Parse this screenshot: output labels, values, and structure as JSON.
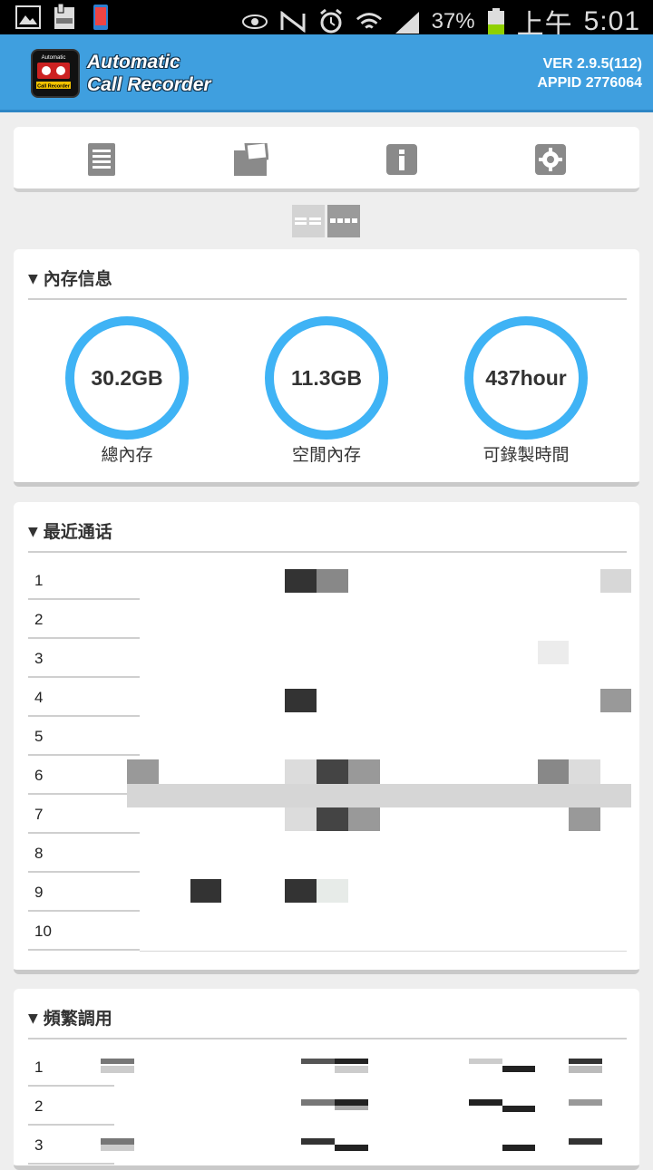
{
  "status_bar": {
    "battery_text": "37%",
    "time_period": "上午",
    "time": "5:01",
    "icons": [
      "gallery-icon",
      "galaxy-icon",
      "phone-icon",
      "eye-icon",
      "nfc-icon",
      "alarm-icon",
      "wifi-icon",
      "signal-icon",
      "battery-icon"
    ]
  },
  "header": {
    "title_line1": "Automatic",
    "title_line2": "Call Recorder",
    "logo_text_top": "Automatic",
    "logo_text_bottom": "Call Recorder",
    "version": "VER 2.9.5(112)",
    "appid": "APPID 2776064",
    "color": "#3f9fdf"
  },
  "toolbar": {
    "icons": [
      "list-icon",
      "folder-icon",
      "info-icon",
      "settings-icon"
    ]
  },
  "storage": {
    "title": "內存信息",
    "items": [
      {
        "value": "30.2GB",
        "label": "總內存"
      },
      {
        "value": "11.3GB",
        "label": "空閒內存"
      },
      {
        "value": "437hour",
        "label": "可錄製時間"
      }
    ],
    "ring_color": "#3fb3f5"
  },
  "recent": {
    "title": "最近通话",
    "rows": [
      "1",
      "2",
      "3",
      "4",
      "5",
      "6",
      "7",
      "8",
      "9",
      "10"
    ]
  },
  "frequent": {
    "title": "頻繁調用",
    "rows": [
      "1",
      "2",
      "3"
    ]
  }
}
